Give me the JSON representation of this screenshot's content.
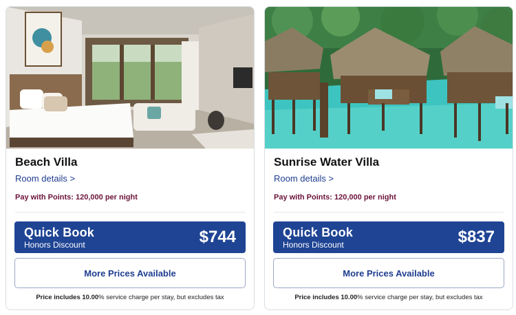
{
  "cards": [
    {
      "name": "Beach Villa",
      "details_link": "Room details >",
      "points_text": "Pay with Points: 120,000 per night",
      "quick_book_title": "Quick Book",
      "quick_book_subtitle": "Honors Discount",
      "price": "$744",
      "more_prices": "More Prices Available",
      "fine_print_pre": "Price includes ",
      "fine_print_pct": "10.00",
      "fine_print_post": "% service charge per stay, but excludes tax"
    },
    {
      "name": "Sunrise Water Villa",
      "details_link": "Room details >",
      "points_text": "Pay with Points: 120,000 per night",
      "quick_book_title": "Quick Book",
      "quick_book_subtitle": "Honors Discount",
      "price": "$837",
      "more_prices": "More Prices Available",
      "fine_print_pre": "Price includes ",
      "fine_print_pct": "10.00",
      "fine_print_post": "% service charge per stay, but excludes tax"
    }
  ],
  "colors": {
    "brand_blue": "#1f4494",
    "link_blue": "#1f3d8f",
    "points_maroon": "#6b1239"
  }
}
